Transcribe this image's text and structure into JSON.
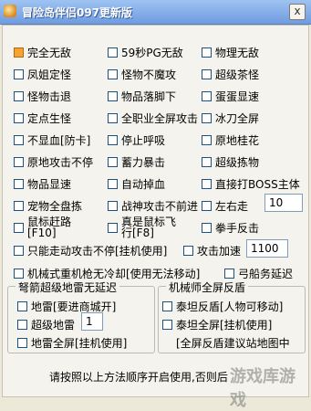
{
  "window": {
    "title": "冒险岛伴侣097更新版",
    "close_label": "x"
  },
  "row1": [
    "完全无敌",
    "59秒PG无敌",
    "物理无敌"
  ],
  "row2": [
    "凤姐定怪",
    "怪物不魔攻",
    "超级茶怪"
  ],
  "row3": [
    "怪物击退",
    "物品落脚下",
    "蛋蛋显速"
  ],
  "row4": [
    "定点生怪",
    "全职业全屏攻击",
    "冰刀全屏"
  ],
  "row5": [
    "不显血[防卡]",
    "停止呼吸",
    "原地桂花"
  ],
  "row6": [
    "原地攻击不停",
    "蓄力暴击",
    "超级拣物"
  ],
  "row7": [
    "物品显速",
    "自动掉血",
    "直接打BOSS主体"
  ],
  "row8": [
    "宠物全盘拣",
    "战神攻击不前进",
    "左右走"
  ],
  "left_right_value": "10",
  "row9": [
    "鼠标赶路\n[F10]",
    "真是鼠标飞\n行[F8]",
    "拳手反击"
  ],
  "only_attack_label": "只能走动攻击不停[挂机使用]",
  "attack_speed_label": "攻击加速",
  "attack_speed_value": "1100",
  "mech_label": "机械式重机枪无冷却[使用无法移动]",
  "archer_label": "弓船务延迟",
  "group_left": {
    "title": "弩箭超级地雷无延迟",
    "items": [
      "地雷[要进商城开]",
      "超级地雷",
      "地雷全屏[挂机使用]"
    ],
    "mine_value": "1"
  },
  "group_right": {
    "title": "机械师全屏反盾",
    "items": [
      "泰坦反盾[人物可移动]",
      "泰坦全屏[挂机使用]"
    ],
    "note": "[全屏反盾建议站地图中"
  },
  "footer_text": "请按照以上方法顺序开启使用,否则后",
  "watermark": "游戏库游戏",
  "colors": {
    "checked_fill": "#f7a233",
    "titlebar": "#6f9be0"
  }
}
